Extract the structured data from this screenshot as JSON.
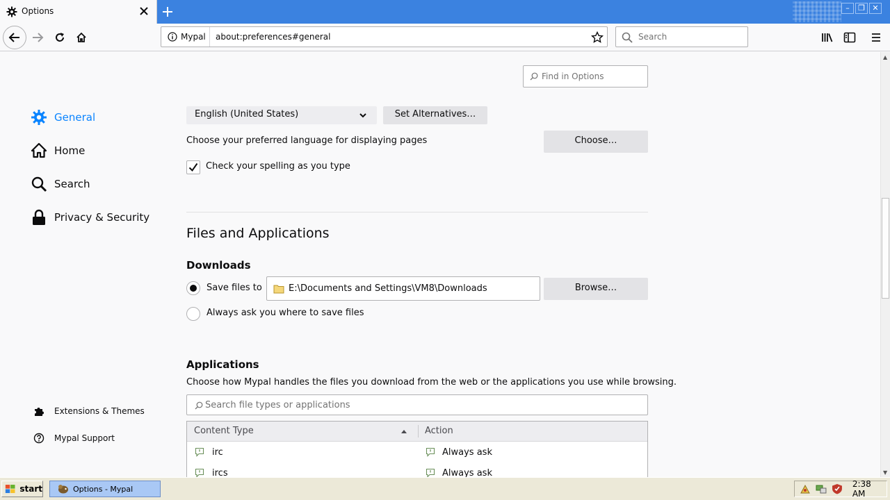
{
  "tab": {
    "title": "Options"
  },
  "window_controls": {
    "minimize": "–",
    "restore": "❐",
    "close": "✕"
  },
  "urlbar": {
    "identity": "Mypal",
    "url": "about:preferences#general"
  },
  "searchbar": {
    "placeholder": "Search"
  },
  "find": {
    "placeholder": "Find in Options"
  },
  "sidebar": {
    "items": [
      {
        "label": "General",
        "icon": "gear-icon",
        "selected": true
      },
      {
        "label": "Home",
        "icon": "home-icon"
      },
      {
        "label": "Search",
        "icon": "magnifier-icon"
      },
      {
        "label": "Privacy & Security",
        "icon": "lock-icon"
      }
    ],
    "footer": [
      {
        "label": "Extensions & Themes",
        "icon": "puzzle-icon"
      },
      {
        "label": "Mypal Support",
        "icon": "help-icon"
      }
    ]
  },
  "language": {
    "selected": "English (United States)",
    "set_alternatives": "Set Alternatives…",
    "pages_label": "Choose your preferred language for displaying pages",
    "choose_button": "Choose…",
    "spellcheck_label": "Check your spelling as you type",
    "spellcheck_checked": true
  },
  "files": {
    "heading": "Files and Applications",
    "downloads_heading": "Downloads",
    "save_files_label": "Save files to",
    "save_files_selected": true,
    "download_path": "E:\\Documents and Settings\\VM8\\Downloads",
    "browse_button": "Browse…",
    "always_ask_label": "Always ask you where to save files"
  },
  "applications": {
    "heading": "Applications",
    "description": "Choose how Mypal handles the files you download from the web or the applications you use while browsing.",
    "search_placeholder": "Search file types or applications",
    "columns": [
      "Content Type",
      "Action"
    ],
    "rows": [
      {
        "type": "irc",
        "action": "Always ask"
      },
      {
        "type": "ircs",
        "action": "Always ask"
      }
    ]
  },
  "taskbar": {
    "start_label": "start",
    "task_label": "Options - Mypal",
    "clock": "2:38 AM"
  },
  "colors": {
    "accent": "#0a84ff",
    "tabstrip": "#3b82e0",
    "taskbar": "#ece9d8"
  }
}
